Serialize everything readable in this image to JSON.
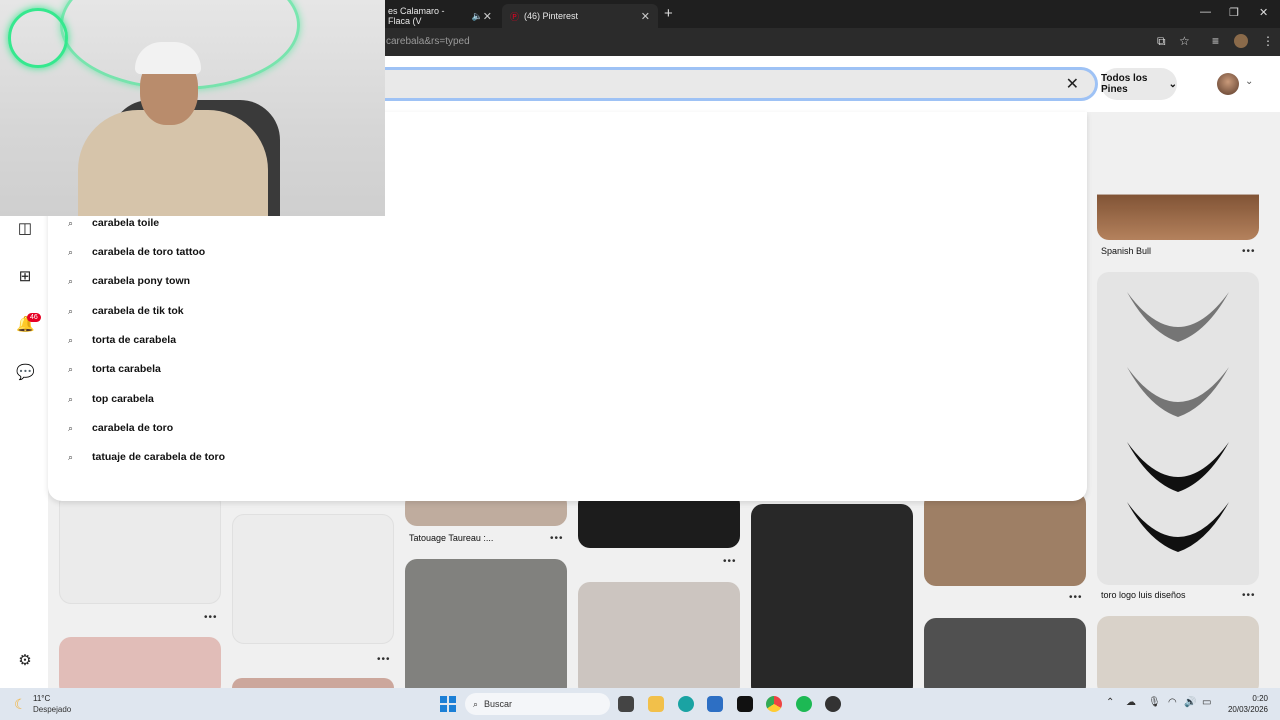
{
  "browser": {
    "tabs": [
      {
        "title": "es Calamaro - Flaca (V",
        "active": false
      },
      {
        "title": "(46) Pinterest",
        "active": true
      }
    ],
    "url": "carebala&rs=typed"
  },
  "header": {
    "filter_label": "Todos los Pines"
  },
  "notifications": {
    "count": "46"
  },
  "suggestions": [
    "carabela toile",
    "carabela de toro tattoo",
    "carabela pony town",
    "carabela de tik tok",
    "torta de carabela",
    "torta carabela",
    "top carabela",
    "carabela de toro",
    "tatuaje de carabela de toro"
  ],
  "pins": {
    "labels": [
      "Spanish Bull",
      "Tatouage Taureau :...",
      "toro logo luis diseños"
    ]
  },
  "taskbar": {
    "temperature": "11°C",
    "weather": "Despejado",
    "search_placeholder": "Buscar",
    "time": "0:20",
    "date": "20/03/2026"
  },
  "colors": {
    "pinterest_red": "#e60023",
    "focus_ring": "#9ec2f5",
    "neon_green": "#35e88e"
  }
}
